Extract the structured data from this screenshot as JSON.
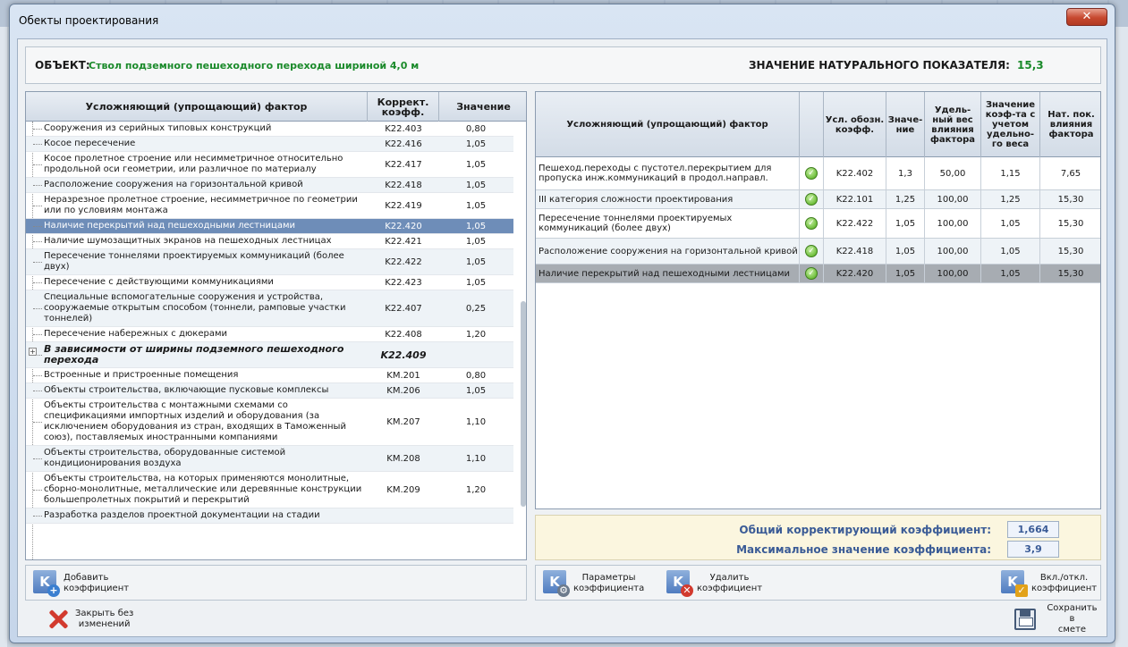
{
  "window": {
    "title": "Обекты проектирования",
    "close_label": "✕"
  },
  "object": {
    "label": "ОБЪЕКТ:",
    "value": "Ствол подземного пешеходного перехода шириной 4,0 м",
    "nat_label": "ЗНАЧЕНИЕ НАТУРАЛЬНОГО ПОКАЗАТЕЛЯ:",
    "nat_value": "15,3"
  },
  "left_table": {
    "headers": {
      "factor": "Усложняющий (упрощающий) фактор",
      "coef": "Коррект. коэфф.",
      "value": "Значение"
    },
    "rows": [
      {
        "name": "Сооружения из серийных типовых конструкций",
        "code": "K22.403",
        "value": "0,80"
      },
      {
        "name": "Косое пересечение",
        "code": "K22.416",
        "value": "1,05"
      },
      {
        "name": "Косое пролетное строение или несимметричное относительно продольной оси геометрии, или различное по материалу",
        "code": "K22.417",
        "value": "1,05"
      },
      {
        "name": "Расположение сооружения на горизонтальной кривой",
        "code": "K22.418",
        "value": "1,05"
      },
      {
        "name": "Неразрезное пролетное строение, несимметричное по геометрии или по условиям монтажа",
        "code": "K22.419",
        "value": "1,05"
      },
      {
        "name": "Наличие перекрытий над пешеходными лестницами",
        "code": "K22.420",
        "value": "1,05"
      },
      {
        "name": "Наличие шумозащитных экранов на пешеходных лестницах",
        "code": "K22.421",
        "value": "1,05"
      },
      {
        "name": "Пересечение тоннелями проектируемых коммуникаций (более двух)",
        "code": "K22.422",
        "value": "1,05"
      },
      {
        "name": "Пересечение с действующими коммуникациями",
        "code": "K22.423",
        "value": "1,05"
      },
      {
        "name": "Специальные вспомогательные сооружения и устройства, сооружаемые открытым способом (тоннели, рамповые участки тоннелей)",
        "code": "K22.407",
        "value": "0,25"
      },
      {
        "name": "Пересечение набережных с дюкерами",
        "code": "K22.408",
        "value": "1,20"
      },
      {
        "name": "В зависимости от ширины подземного пешеходного перехода",
        "code": "K22.409",
        "value": ""
      },
      {
        "name": "Встроенные и пристроенные помещения",
        "code": "KM.201",
        "value": "0,80"
      },
      {
        "name": "Объекты строительства, включающие пусковые комплексы",
        "code": "KM.206",
        "value": "1,05"
      },
      {
        "name": "Объекты строительства с монтажными схемами со спецификациями импортных изделий и оборудования (за исключением оборудования из стран, входящих в Таможенный союз), поставляемых иностранными компаниями",
        "code": "KM.207",
        "value": "1,10"
      },
      {
        "name": "Объекты строительства, оборудованные системой кондиционирования воздуха",
        "code": "KM.208",
        "value": "1,10"
      },
      {
        "name": "Объекты строительства, на которых применяются монолитные, сборно-монолитные, металлические или деревянные конструкции большепролетных покрытий и перекрытий",
        "code": "KM.209",
        "value": "1,20"
      },
      {
        "name": "Разработка разделов проектной документации на стадии",
        "code": "",
        "value": ""
      }
    ]
  },
  "right_table": {
    "headers": {
      "factor": "Усложняющий (упрощающий) фактор",
      "code": "Усл. обозн. коэфф.",
      "value": "Значе-ние",
      "weight": "Удель-ный вес влияния фактора",
      "coef_weight": "Значение коэф-та с учетом удельно-го веса",
      "nat": "Нат. пок. влияния фактора"
    },
    "rows": [
      {
        "name": "Пешеход.переходы с пустотел.перекрытием для пропуска инж.коммуникаций в продол.направл.",
        "code": "K22.402",
        "value": "1,3",
        "weight": "50,00",
        "coef_weight": "1,15",
        "nat": "7,65"
      },
      {
        "name": "III категория сложности проектирования",
        "code": "K22.101",
        "value": "1,25",
        "weight": "100,00",
        "coef_weight": "1,25",
        "nat": "15,30"
      },
      {
        "name": "Пересечение тоннелями проектируемых коммуникаций (более двух)",
        "code": "K22.422",
        "value": "1,05",
        "weight": "100,00",
        "coef_weight": "1,05",
        "nat": "15,30"
      },
      {
        "name": "Расположение сооружения на горизонтальной кривой",
        "code": "K22.418",
        "value": "1,05",
        "weight": "100,00",
        "coef_weight": "1,05",
        "nat": "15,30"
      },
      {
        "name": "Наличие перекрытий над пешеходными лестницами",
        "code": "K22.420",
        "value": "1,05",
        "weight": "100,00",
        "coef_weight": "1,05",
        "nat": "15,30"
      }
    ]
  },
  "summary": {
    "total_label": "Общий корректирующий коэффициент:",
    "total_value": "1,664",
    "max_label": "Максимальное значение коэффициента:",
    "max_value": "3,9"
  },
  "buttons": {
    "add_line1": "Добавить",
    "add_line2": "коэффициент",
    "params_line1": "Параметры",
    "params_line2": "коэффициента",
    "delete_line1": "Удалить",
    "delete_line2": "коэффициент",
    "toggle_line1": "Вкл./откл.",
    "toggle_line2": "коэффициент",
    "close_line1": "Закрыть без",
    "close_line2": "изменений",
    "save_line1": "Сохранить в",
    "save_line2": "смете"
  },
  "colors": {
    "accent_green": "#1a8a2a",
    "summary_blue": "#3a5b96",
    "selection": "#6e8db8"
  },
  "icons": {
    "add": "k-plus-icon",
    "params": "k-gear-icon",
    "delete": "k-delete-icon",
    "toggle": "k-check-icon",
    "close": "red-x-icon",
    "save": "floppy-disk-icon",
    "row_status": "check-circle-icon"
  }
}
